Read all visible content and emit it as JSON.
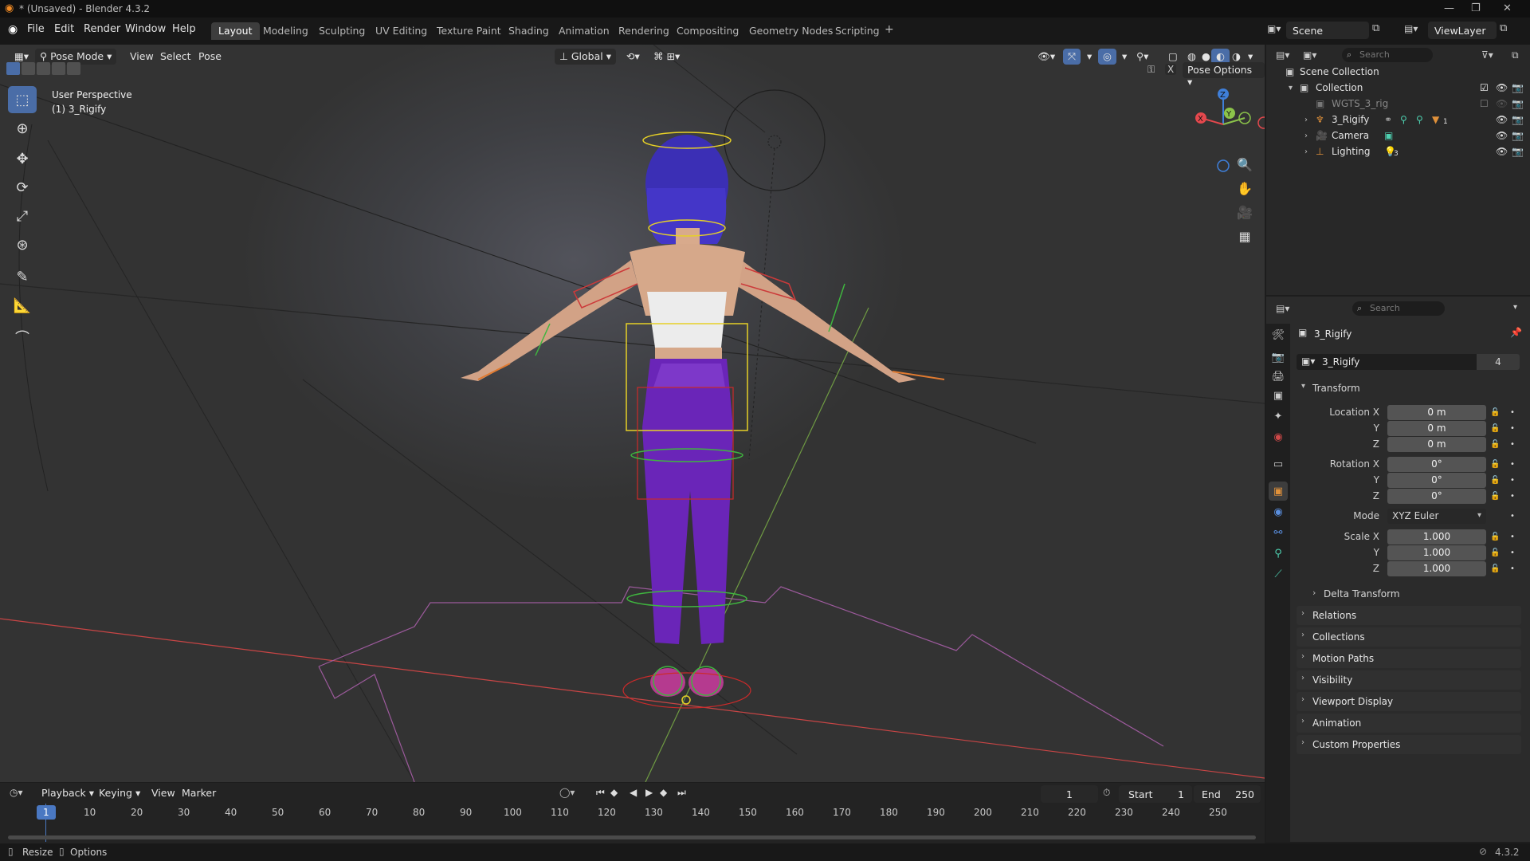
{
  "window": {
    "title": "* (Unsaved) - Blender 4.3.2",
    "version": "4.3.2"
  },
  "menu": [
    "File",
    "Edit",
    "Render",
    "Window",
    "Help"
  ],
  "workspaces": [
    "Layout",
    "Modeling",
    "Sculpting",
    "UV Editing",
    "Texture Paint",
    "Shading",
    "Animation",
    "Rendering",
    "Compositing",
    "Geometry Nodes",
    "Scripting"
  ],
  "active_workspace": "Layout",
  "scene": {
    "name": "Scene",
    "view_layer": "ViewLayer"
  },
  "viewport": {
    "mode": "Pose Mode",
    "menus": [
      "View",
      "Select",
      "Pose"
    ],
    "orientation": "Global",
    "pose_options": "Pose Options",
    "overlay_text": [
      "User Perspective",
      "(1) 3_Rigify"
    ],
    "gizmo_axes": {
      "x": "X",
      "y": "Y",
      "z": "Z"
    }
  },
  "outliner": {
    "search_placeholder": "Search",
    "root": "Scene Collection",
    "collection": "Collection",
    "items": [
      {
        "name": "WGTS_3_rig",
        "dimmed": true
      },
      {
        "name": "3_Rigify",
        "badge": "1"
      },
      {
        "name": "Camera"
      },
      {
        "name": "Lighting",
        "badge": "3"
      }
    ]
  },
  "properties": {
    "search_placeholder": "Search",
    "object_name": "3_Rigify",
    "datablock_name": "3_Rigify",
    "users": "4",
    "transform_label": "Transform",
    "location": {
      "label": "Location X",
      "x": "0 m",
      "y": "0 m",
      "z": "0 m"
    },
    "rotation": {
      "label": "Rotation X",
      "x": "0°",
      "y": "0°",
      "z": "0°"
    },
    "mode": {
      "label": "Mode",
      "value": "XYZ Euler"
    },
    "scale": {
      "label": "Scale X",
      "x": "1.000",
      "y": "1.000",
      "z": "1.000"
    },
    "axis_labels": {
      "y": "Y",
      "z": "Z"
    },
    "delta": "Delta Transform",
    "panels": [
      "Relations",
      "Collections",
      "Motion Paths",
      "Visibility",
      "Viewport Display",
      "Animation",
      "Custom Properties"
    ]
  },
  "timeline": {
    "menus": [
      "Playback",
      "Keying",
      "View",
      "Marker"
    ],
    "current_frame": "1",
    "start_label": "Start",
    "start": "1",
    "end_label": "End",
    "end": "250",
    "ruler": [
      "1",
      "10",
      "20",
      "30",
      "40",
      "50",
      "60",
      "70",
      "80",
      "90",
      "100",
      "110",
      "120",
      "130",
      "140",
      "150",
      "160",
      "170",
      "180",
      "190",
      "200",
      "210",
      "220",
      "230",
      "240",
      "250"
    ]
  },
  "statusbar": {
    "left": [
      "Resize",
      "Options"
    ],
    "right": "4.3.2"
  },
  "colors": {
    "accent": "#4a6da7",
    "x_axis": "#e5484d",
    "y_axis": "#8bc34a",
    "z_axis": "#3f7fd9",
    "frame_marker": "#4a78c2"
  }
}
